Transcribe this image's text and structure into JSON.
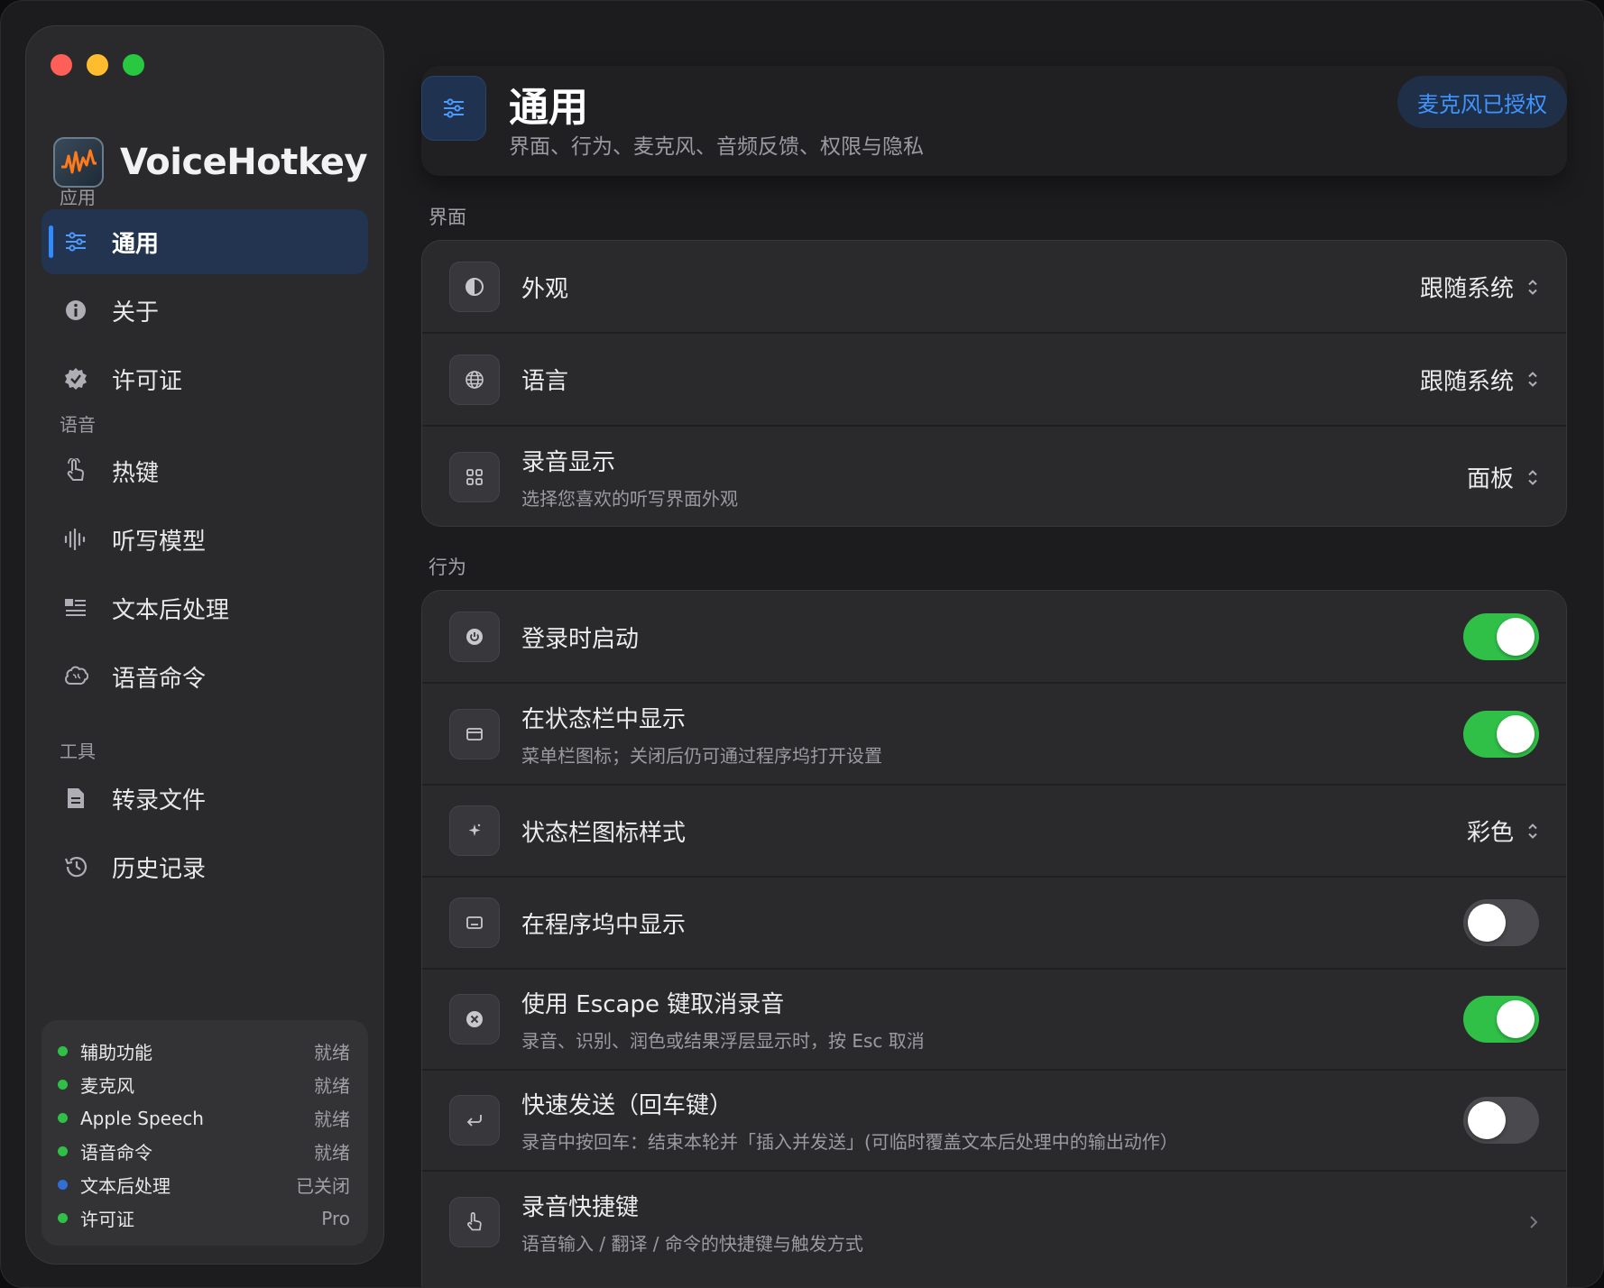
{
  "app": {
    "name": "VoiceHotkey"
  },
  "sidebar": {
    "sections": [
      {
        "label": "应用",
        "items": [
          {
            "label": "通用",
            "icon": "sliders-icon",
            "active": true
          },
          {
            "label": "关于",
            "icon": "info-icon"
          },
          {
            "label": "许可证",
            "icon": "verified-badge-icon"
          }
        ]
      },
      {
        "label": "语音",
        "items": [
          {
            "label": "热键",
            "icon": "hand-pointer-icon"
          },
          {
            "label": "听写模型",
            "icon": "waveform-icon"
          },
          {
            "label": "文本后处理",
            "icon": "text-list-icon"
          },
          {
            "label": "语音命令",
            "icon": "brain-icon"
          }
        ]
      },
      {
        "label": "工具",
        "items": [
          {
            "label": "转录文件",
            "icon": "document-icon"
          },
          {
            "label": "历史记录",
            "icon": "history-icon"
          }
        ]
      }
    ],
    "status": [
      {
        "name": "辅助功能",
        "value": "就绪",
        "color": "#30c048"
      },
      {
        "name": "麦克风",
        "value": "就绪",
        "color": "#30c048"
      },
      {
        "name": "Apple Speech",
        "value": "就绪",
        "color": "#30c048"
      },
      {
        "name": "语音命令",
        "value": "就绪",
        "color": "#30c048"
      },
      {
        "name": "文本后处理",
        "value": "已关闭",
        "color": "#2f6fd6"
      },
      {
        "name": "许可证",
        "value": "Pro",
        "color": "#30c048"
      }
    ]
  },
  "header": {
    "title": "通用",
    "subtitle": "界面、行为、麦克风、音频反馈、权限与隐私",
    "badge": "麦克风已授权",
    "icon": "sliders-icon"
  },
  "groups": {
    "interface": {
      "label": "界面",
      "rows": [
        {
          "title": "外观",
          "value": "跟随系统",
          "icon": "contrast-icon"
        },
        {
          "title": "语言",
          "value": "跟随系统",
          "icon": "globe-icon"
        },
        {
          "title": "录音显示",
          "desc": "选择您喜欢的听写界面外观",
          "value": "面板",
          "icon": "grid-icon"
        }
      ]
    },
    "behavior": {
      "label": "行为",
      "rows": [
        {
          "title": "登录时启动",
          "toggle": true,
          "icon": "power-icon"
        },
        {
          "title": "在状态栏中显示",
          "desc": "菜单栏图标；关闭后仍可通过程序坞打开设置",
          "toggle": true,
          "icon": "window-icon"
        },
        {
          "title": "状态栏图标样式",
          "value": "彩色",
          "icon": "sparkle-icon"
        },
        {
          "title": "在程序坞中显示",
          "toggle": false,
          "icon": "dock-icon"
        },
        {
          "title": "使用 Escape 键取消录音",
          "desc": "录音、识别、润色或结果浮层显示时，按 Esc 取消",
          "toggle": true,
          "icon": "xmark-circle-icon"
        },
        {
          "title": "快速发送（回车键）",
          "desc": "录音中按回车：结束本轮并「插入并发送」(可临时覆盖文本后处理中的输出动作）",
          "toggle": false,
          "icon": "return-icon"
        },
        {
          "title": "录音快捷键",
          "desc": "语音输入 / 翻译 / 命令的快捷键与触发方式",
          "icon": "hand-pointer-icon"
        }
      ]
    }
  },
  "colors": {
    "accent": "#2f8cff",
    "toggle_on": "#30c048",
    "toggle_off": "#4a4a4e"
  }
}
